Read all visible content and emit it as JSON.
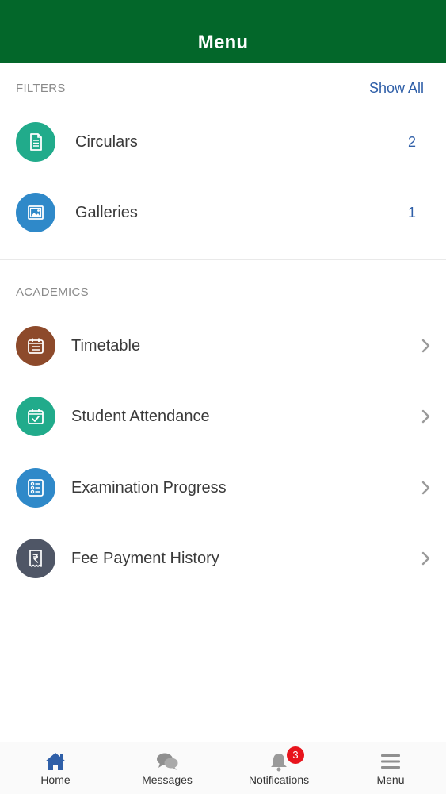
{
  "header": {
    "title": "Menu"
  },
  "filters": {
    "label": "FILTERS",
    "show_all": "Show All",
    "items": [
      {
        "label": "Circulars",
        "count": "2",
        "icon": "document-icon",
        "color": "#21ab8b"
      },
      {
        "label": "Galleries",
        "count": "1",
        "icon": "image-icon",
        "color": "#2f89c9"
      }
    ]
  },
  "academics": {
    "label": "ACADEMICS",
    "items": [
      {
        "label": "Timetable",
        "icon": "calendar-list-icon",
        "color": "#8d4a2b"
      },
      {
        "label": "Student Attendance",
        "icon": "calendar-check-icon",
        "color": "#21ab8b"
      },
      {
        "label": "Examination Progress",
        "icon": "checklist-icon",
        "color": "#2f89c9"
      },
      {
        "label": "Fee Payment History",
        "icon": "rupee-receipt-icon",
        "color": "#4f5666"
      }
    ]
  },
  "tabbar": {
    "tabs": [
      {
        "label": "Home",
        "icon": "home-icon"
      },
      {
        "label": "Messages",
        "icon": "chat-bubbles-icon"
      },
      {
        "label": "Notifications",
        "icon": "bell-icon",
        "badge": "3"
      },
      {
        "label": "Menu",
        "icon": "hamburger-icon"
      }
    ]
  },
  "colors": {
    "header_bg": "#03672a",
    "accent_blue": "#2f5fa8",
    "badge_red": "#e8141c"
  }
}
